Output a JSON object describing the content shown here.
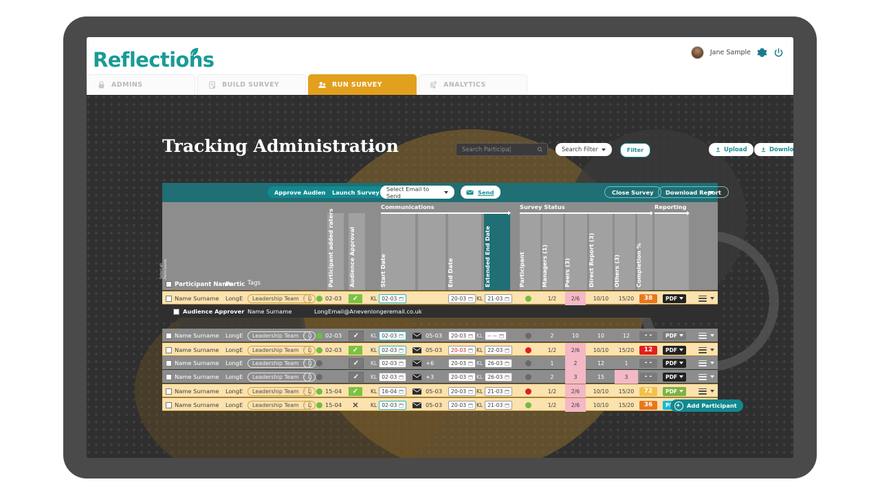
{
  "app": {
    "logo_text": "Reflections",
    "user_name": "Jane Sample"
  },
  "tabs": [
    {
      "label": "ADMINS",
      "icon": "lock-icon",
      "active": false
    },
    {
      "label": "BUILD SURVEY",
      "icon": "document-icon",
      "active": false
    },
    {
      "label": "RUN SURVEY",
      "icon": "people-icon",
      "active": true
    },
    {
      "label": "ANALYTICS",
      "icon": "analytics-icon",
      "active": false
    }
  ],
  "page": {
    "title": "Tracking Administration",
    "search_placeholder": "Search Participa|",
    "search_value": "",
    "search_filter_label": "Search Filter",
    "filter_button": "Filter",
    "upload_button": "Upload",
    "download_button": "Download"
  },
  "toolbar": {
    "approve_audience": "Approve Audience",
    "launch_survey": "Launch Survey",
    "email_select": "Select Email to Send",
    "send_button": "Send",
    "close_survey": "Close Survey",
    "download_report": "Download Report"
  },
  "grid": {
    "groups": [
      {
        "label": "Communications"
      },
      {
        "label": "Survey Status"
      },
      {
        "label": "Reporting"
      }
    ],
    "headers": {
      "select_all": "Select all\nParticipants",
      "participant_name": "Participant Name",
      "partic": "Partic",
      "tags": "Tags",
      "participant_added_raters": "Participant added raters",
      "audience_approval": "Audience Approval",
      "start_date": "Start Date",
      "end_date": "End Date",
      "extended_end_date": "Extended End Date",
      "participant": "Participant",
      "managers": "Managers  (1)",
      "peers": "Peers  (3)",
      "direct_report": "Direct Report  (3)",
      "others": "Others  (3)",
      "completion": "Completion %"
    },
    "rows": [
      {
        "style": "amber",
        "name": "Name Surname",
        "partic": "LongE",
        "tag": "Leadership Team",
        "rater_letter": "L",
        "rater_dot": "#6fbf3e",
        "rater_date": "02-03",
        "approval": "check",
        "approval_color": "#7cc242",
        "start_kl": "KL",
        "start_date": "02-03",
        "start_highlight": true,
        "email_icon": false,
        "email_count": "",
        "end_date": "20-03",
        "ext_kl": "KL",
        "ext_date": "21-03",
        "ext_red": false,
        "status_dot": "#6fbf3e",
        "participant": "1/2",
        "managers": "2/6",
        "managers_pink": true,
        "peers": "10/10",
        "direct": "15/20",
        "others": "",
        "completion": "38",
        "completion_color": "#e8781c",
        "pdf": "PDF",
        "pdf_color": "#222222"
      },
      {
        "style": "grey",
        "name": "Name Surname",
        "partic": "LongE",
        "tag": "Leadership Team",
        "rater_letter": "L",
        "rater_dot": "#6fbf3e",
        "rater_date": "02-03",
        "approval": "check",
        "approval_color": "#7a7a7a",
        "start_kl": "KL",
        "start_date": "02-03",
        "start_highlight": true,
        "email_icon": true,
        "email_count": "05-03",
        "end_date": "20-03",
        "ext_kl": "KL",
        "ext_date": "-- --",
        "ext_red": false,
        "status_dot": "#6a6a6a",
        "participant": "2",
        "managers": "10",
        "managers_pink": false,
        "peers": "10",
        "direct": "12",
        "others": "",
        "completion": "- -",
        "completion_color": "#7a7a7a",
        "pdf": "PDF",
        "pdf_color": "#7a7a7a"
      },
      {
        "style": "amber",
        "name": "Name Surname",
        "partic": "LongE",
        "tag": "Leadership Team",
        "rater_letter": "L",
        "rater_dot": "#6fbf3e",
        "rater_date": "02-03",
        "approval": "check",
        "approval_color": "#7cc242",
        "start_kl": "KL",
        "start_date": "02-03",
        "start_highlight": true,
        "email_icon": true,
        "email_count": "05-03",
        "end_date": "20-03",
        "ext_kl": "KL",
        "ext_date": "22-03",
        "ext_red": true,
        "status_dot": "#e02020",
        "participant": "1/2",
        "managers": "2/6",
        "managers_pink": true,
        "peers": "10/10",
        "direct": "15/20",
        "others": "",
        "completion": "12",
        "completion_color": "#e02020",
        "pdf": "PDF",
        "pdf_color": "#222222"
      },
      {
        "style": "grey",
        "name": "Name Surname",
        "partic": "LongE",
        "tag": "Leadership Team",
        "rater_letter": "L",
        "rater_dot": "#6a6a6a",
        "rater_date": "",
        "approval": "check",
        "approval_color": "#7a7a7a",
        "start_kl": "KL",
        "start_date": "02-03",
        "start_highlight": false,
        "email_icon": true,
        "email_count": "+6",
        "end_date": "20-03",
        "ext_kl": "KL",
        "ext_date": "26-03",
        "ext_red": false,
        "status_dot": "#6a6a6a",
        "participant": "1",
        "managers": "2",
        "managers_pink": true,
        "peers": "12",
        "direct": "1",
        "others": "",
        "completion": "- -",
        "completion_color": "#7a7a7a",
        "pdf": "PDF",
        "pdf_color": "#222222"
      },
      {
        "style": "grey",
        "name": "Name Surname",
        "partic": "LongE",
        "tag": "Leadership Team",
        "rater_letter": "L",
        "rater_dot": "#6a6a6a",
        "rater_date": "",
        "approval": "check",
        "approval_color": "#7a7a7a",
        "start_kl": "KL",
        "start_date": "02-03",
        "start_highlight": false,
        "email_icon": true,
        "email_count": "+3",
        "end_date": "20-03",
        "ext_kl": "KL",
        "ext_date": "26-03",
        "ext_red": false,
        "status_dot": "#6a6a6a",
        "participant": "2",
        "managers": "3",
        "managers_pink": true,
        "peers": "15",
        "direct": "3",
        "others": "",
        "completion": "- -",
        "completion_color": "#7a7a7a",
        "pdf": "PDF",
        "pdf_color": "#222222"
      },
      {
        "style": "amber",
        "name": "Name Surname",
        "partic": "LongE",
        "tag": "Leadership Team",
        "rater_letter": "L",
        "rater_dot": "#6fbf3e",
        "rater_date": "15-04",
        "approval": "check",
        "approval_color": "#7cc242",
        "start_kl": "KL",
        "start_date": "16-04",
        "start_highlight": false,
        "email_icon": true,
        "email_count": "05-03",
        "end_date": "20-03",
        "ext_kl": "KL",
        "ext_date": "21-03",
        "ext_red": false,
        "status_dot": "#e02020",
        "participant": "1/2",
        "managers": "2/6",
        "managers_pink": true,
        "peers": "10/10",
        "direct": "15/20",
        "others": "",
        "completion": "72",
        "completion_color": "#f3c14a",
        "pdf": "PDF",
        "pdf_color": "#7cb342"
      },
      {
        "style": "amber",
        "name": "Name Surname",
        "partic": "LongE",
        "tag": "Leadership Team",
        "rater_letter": "L",
        "rater_dot": "#6fbf3e",
        "rater_date": "15-04",
        "approval": "cross",
        "approval_color": "#4a4a4a",
        "start_kl": "KL",
        "start_date": "02-03",
        "start_highlight": true,
        "email_icon": true,
        "email_count": "05-03",
        "end_date": "20-03",
        "ext_kl": "KL",
        "ext_date": "21-03",
        "ext_red": false,
        "status_dot": "#6fbf3e",
        "participant": "1/2",
        "managers": "2/6",
        "managers_pink": true,
        "peers": "10/10",
        "direct": "15/20",
        "others": "",
        "completion": "36",
        "completion_color": "#e8781c",
        "pdf": "PDF",
        "pdf_color": "#18b8d6"
      }
    ],
    "sub_row": {
      "label": "Audience Approver",
      "name": "Name Surname",
      "email": "LongEmail@Anevenlongeremail.co.uk"
    },
    "add_participant": "Add Participant"
  }
}
